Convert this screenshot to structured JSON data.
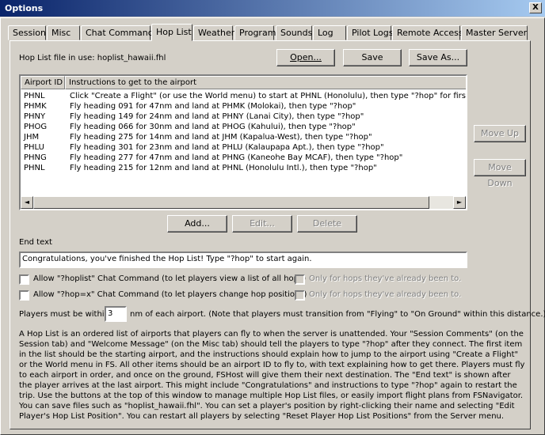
{
  "window": {
    "title": "Options",
    "close_label": "X"
  },
  "tabs": [
    {
      "label": "Session"
    },
    {
      "label": "Misc"
    },
    {
      "label": "Chat Commands"
    },
    {
      "label": "Hop List"
    },
    {
      "label": "Weather"
    },
    {
      "label": "Program"
    },
    {
      "label": "Sounds"
    },
    {
      "label": "Log"
    },
    {
      "label": "Pilot Logs"
    },
    {
      "label": "Remote Access"
    },
    {
      "label": "Master Server"
    }
  ],
  "active_tab": "Hop List",
  "hoplist": {
    "file_label": "Hop List file in use: hoplist_hawaii.fhl",
    "open_label": "Open...",
    "save_label": "Save",
    "saveas_label": "Save As...",
    "col_airport": "Airport ID",
    "col_instructions": "Instructions to get to the airport",
    "rows": [
      {
        "id": "PHNL",
        "text": "Click \"Create a Flight\" (or use the World menu) to start at PHNL (Honolulu), then type \"?hop\" for first hop in"
      },
      {
        "id": "PHMK",
        "text": "Fly heading 091 for 47nm and land at PHMK (Molokai), then type \"?hop\""
      },
      {
        "id": "PHNY",
        "text": "Fly heading 149 for 24nm and land at PHNY (Lanai City), then type \"?hop\""
      },
      {
        "id": "PHOG",
        "text": "Fly heading 066 for 30nm and land at PHOG (Kahului), then type \"?hop\""
      },
      {
        "id": "JHM",
        "text": "Fly heading 275 for 14nm and land at JHM (Kapalua-West), then type \"?hop\""
      },
      {
        "id": "PHLU",
        "text": "Fly heading 301 for 23nm and land at PHLU (Kalaupapa Apt.), then type \"?hop\""
      },
      {
        "id": "PHNG",
        "text": "Fly heading 277 for 47nm and land at PHNG (Kaneohe Bay MCAF), then type \"?hop\""
      },
      {
        "id": "PHNL",
        "text": "Fly heading 215 for 12nm and land at PHNL (Honolulu Intl.), then type \"?hop\""
      }
    ],
    "scroll_left": "◄",
    "scroll_right": "►",
    "move_up_label": "Move Up",
    "move_down_label": "Move Down",
    "add_label": "Add...",
    "edit_label": "Edit...",
    "delete_label": "Delete",
    "end_text_label": "End text",
    "end_text_value": "Congratulations, you've finished the Hop List! Type \"?hop\" to start again.",
    "allow_hoplist_label": "Allow \"?hoplist\" Chat Command (to let players view a list of all hops)",
    "allow_hoplist_checked": false,
    "only_hops_label_1": "Only for hops they've already been to.",
    "allow_hopx_label": "Allow \"?hop=x\" Chat Command (to let players change hop positions)",
    "allow_hopx_checked": false,
    "only_hops_label_2": "Only for hops they've already been to.",
    "within_prefix": "Players must be within",
    "within_value": "3",
    "within_suffix": "nm of each airport. (Note that players must transition from \"Flying\" to \"On Ground\" within this distance.)",
    "description": "A Hop List is an ordered list of airports that players can fly to when the server is unattended. Your \"Session Comments\" (on the Session tab) and \"Welcome Message\" (on the Misc tab) should tell the players to type \"?hop\" after they connect. The first item in the list should be the starting airport, and the instructions should explain how to jump to the airport using \"Create a Flight\" or the World menu in FS. All other items should be an airport ID to fly to, with text explaining how to get there. Players must fly to each airport in order, and once on the ground, FSHost will give them their next destination. The \"End text\" is shown after the player arrives at the last airport. This might include \"Congratulations\" and instructions to type \"?hop\" again to restart the trip. Use the buttons at the top of this window to manage multiple Hop List files, or easily import flight plans from FSNavigator. You can save files such as \"hoplist_hawaii.fhl\". You can set a player's position by right-clicking their name and selecting \"Edit Player's Hop List Position\". You can restart all players by selecting \"Reset Player Hop List Positions\" from the Server menu."
  }
}
